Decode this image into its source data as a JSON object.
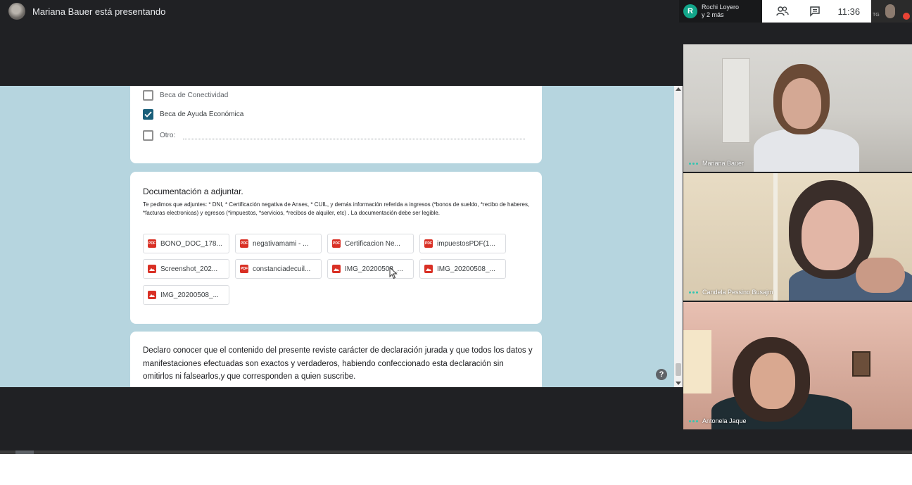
{
  "top_bar": {
    "presenter_text": "Mariana Bauer está presentando",
    "participants_initial": "R",
    "participants_line1": "Rochi Loyero",
    "participants_line2": "y 2 más",
    "time": "11:36",
    "self_initials": "TG"
  },
  "form": {
    "checkboxes": [
      {
        "label": "Beca de Conectividad",
        "checked": false
      },
      {
        "label": "Beca de Ayuda Económica",
        "checked": true
      },
      {
        "label": "Otro:",
        "checked": false
      }
    ],
    "documents": {
      "title": "Documentación a adjuntar.",
      "description": "Te pedimos que adjuntes: * DNI, * Certificación negativa de Anses, * CUIL, y demás información referida a ingresos (*bonos de sueldo, *recibo de haberes, *facturas electronicas) y egresos (*impuestos, *servicios, *recibos de alquiler, etc) . La documentación debe ser legible.",
      "files": [
        {
          "name": "BONO_DOC_178...",
          "type": "pdf"
        },
        {
          "name": "negativamami - ...",
          "type": "pdf"
        },
        {
          "name": "Certificacion Ne...",
          "type": "pdf"
        },
        {
          "name": "impuestosPDF(1...",
          "type": "pdf"
        },
        {
          "name": "Screenshot_202...",
          "type": "image"
        },
        {
          "name": "constanciadecuil...",
          "type": "pdf"
        },
        {
          "name": "IMG_20200508_...",
          "type": "image"
        },
        {
          "name": "IMG_20200508_...",
          "type": "image"
        },
        {
          "name": "IMG_20200508_...",
          "type": "image"
        }
      ]
    },
    "declaration": "Declaro conocer que el contenido del presente reviste carácter de declaración jurada y que todos los datos y manifestaciones efectuadas son exactos y verdaderos, habiendo confeccionado esta declaración sin omitirlos ni falsearlos,y que corresponden a quien suscribe.",
    "help_symbol": "?"
  },
  "participants": [
    {
      "name": "Mariana Bauer"
    },
    {
      "name": "Candela Pessino Busajm"
    },
    {
      "name": "Antonela Jaque"
    }
  ],
  "colors": {
    "meet_background": "#202124",
    "share_background": "#b6d5df",
    "checkbox_checked": "#1a5f7a",
    "pdf_icon": "#d93025",
    "active_dots": "#34c5b1"
  }
}
